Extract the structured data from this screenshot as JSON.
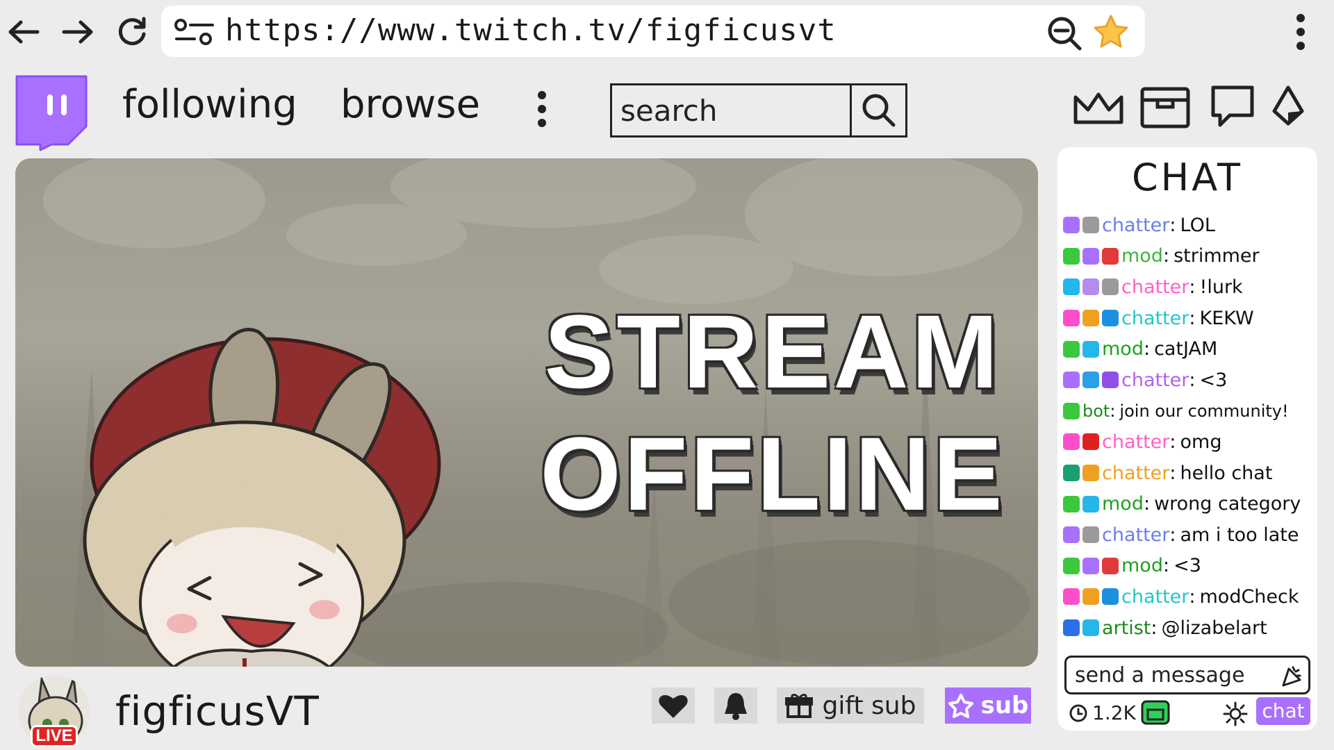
{
  "browser": {
    "url": "https://www.twitch.tv/figficusvt",
    "icons": [
      "back-arrow-icon",
      "forward-arrow-icon",
      "reload-icon",
      "site-settings-icon",
      "zoom-out-icon",
      "star-icon",
      "kebab-menu-icon"
    ]
  },
  "header": {
    "following": "following",
    "browse": "browse",
    "search_placeholder": "search",
    "icons": [
      "crown-icon",
      "inbox-icon",
      "whisper-icon",
      "bits-icon"
    ]
  },
  "player": {
    "line1": "STREAM",
    "line2": "OFFLINE"
  },
  "channel": {
    "name": "figficusVT",
    "live": "LIVE",
    "gift_sub": "gift sub",
    "sub": "sub"
  },
  "chat": {
    "title": "CHAT",
    "messages": [
      {
        "user": "chatter",
        "text": "LOL",
        "color": "#6a7fe8",
        "badges": [
          "#a970ff",
          "#9a9a9a"
        ]
      },
      {
        "user": "mod",
        "text": "strimmer",
        "color": "#3cb43c",
        "badges": [
          "#3cc83c",
          "#a970ff",
          "#e03a3a"
        ]
      },
      {
        "user": "chatter",
        "text": "!lurk",
        "color": "#ff5fc8",
        "badges": [
          "#25b6ea",
          "#b48cf0",
          "#9a9a9a"
        ]
      },
      {
        "user": "chatter",
        "text": "KEKW",
        "color": "#21c8c8",
        "badges": [
          "#ff4ec9",
          "#f0a020",
          "#1e90e0"
        ]
      },
      {
        "user": "mod",
        "text": "catJAM",
        "color": "#1ea01e",
        "badges": [
          "#3cc83c",
          "#25b6ea"
        ]
      },
      {
        "user": "chatter",
        "text": "<3",
        "color": "#b460f0",
        "badges": [
          "#a970ff",
          "#2aa0e8",
          "#9050e8"
        ]
      },
      {
        "user": "bot",
        "text": "join our community!",
        "color": "#1a8a1a",
        "badges": [
          "#3cc83c"
        ]
      },
      {
        "user": "chatter",
        "text": "omg",
        "color": "#ff5fc8",
        "badges": [
          "#ff4ec9",
          "#e02020"
        ]
      },
      {
        "user": "chatter",
        "text": "hello chat",
        "color": "#f0a020",
        "badges": [
          "#18a070",
          "#f0a020"
        ]
      },
      {
        "user": "mod",
        "text": "wrong category",
        "color": "#1ea01e",
        "badges": [
          "#3cc83c",
          "#25b6ea"
        ]
      },
      {
        "user": "chatter",
        "text": "am i too late",
        "color": "#6a7fe8",
        "badges": [
          "#a970ff",
          "#9a9a9a"
        ]
      },
      {
        "user": "mod",
        "text": "<3",
        "color": "#1ea01e",
        "badges": [
          "#3cc83c",
          "#a970ff",
          "#e03a3a"
        ]
      },
      {
        "user": "chatter",
        "text": "modCheck",
        "color": "#21c8c8",
        "badges": [
          "#ff4ec9",
          "#f0a020",
          "#1e90e0"
        ]
      },
      {
        "user": "artist",
        "text": "@lizabelart",
        "color": "#1a8a1a",
        "badges": [
          "#2a70e8",
          "#25b6ea"
        ]
      }
    ],
    "send_placeholder": "send a message",
    "viewers": "1.2K",
    "chat_button": "chat"
  }
}
